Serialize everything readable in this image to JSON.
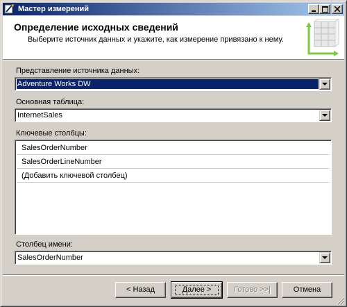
{
  "window": {
    "title": "Мастер измерений"
  },
  "header": {
    "title": "Определение исходных сведений",
    "subtitle": "Выберите источник данных и укажите, как измерение привязано к нему."
  },
  "form": {
    "data_source_view": {
      "label": "Представление источника данных:",
      "value": "Adventure Works DW"
    },
    "main_table": {
      "label": "Основная таблица:",
      "value": "InternetSales"
    },
    "key_columns": {
      "label": "Ключевые столбцы:",
      "rows": [
        "SalesOrderNumber",
        "SalesOrderLineNumber",
        "(Добавить ключевой столбец)"
      ]
    },
    "name_column": {
      "label": "Столбец имени:",
      "value": "SalesOrderNumber"
    }
  },
  "buttons": {
    "back": "< Назад",
    "next": "Далее >",
    "finish": "Готово >>|",
    "cancel": "Отмена"
  },
  "icons": {
    "app": "wizard-icon",
    "header": "dimension-cube-icon",
    "minimize": "minimize-icon",
    "maximize": "maximize-icon",
    "close": "close-icon"
  },
  "colors": {
    "title_bar_start": "#0a246a",
    "title_bar_end": "#a6caf0",
    "selection": "#0a246a",
    "face": "#d4d0c8"
  }
}
